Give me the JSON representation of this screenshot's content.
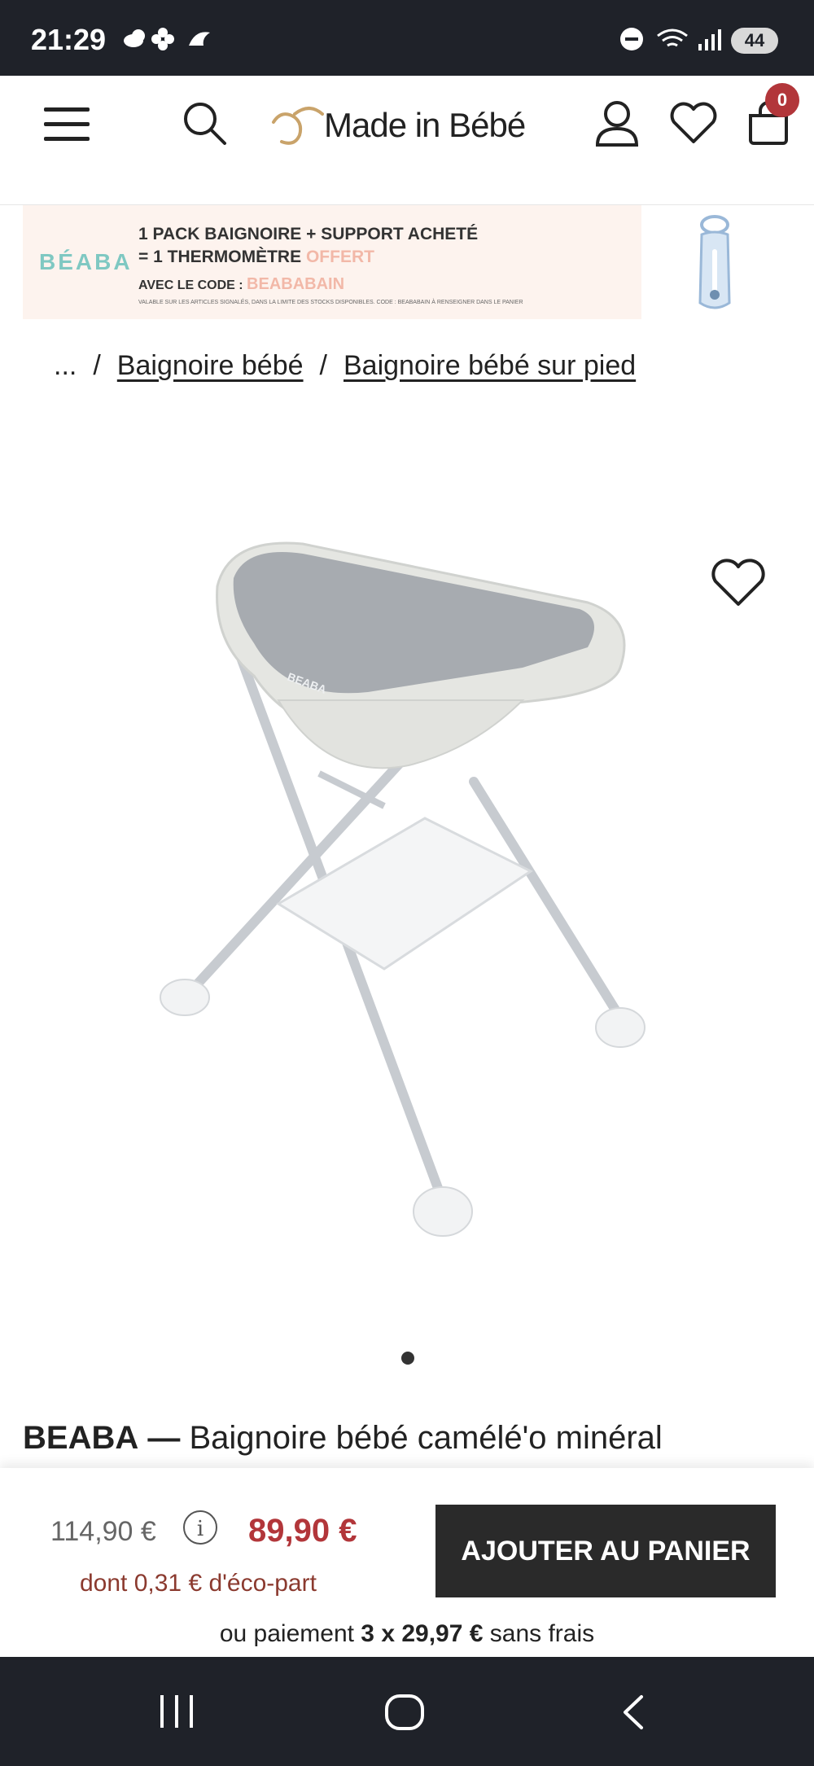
{
  "status_bar": {
    "time": "21:29",
    "battery": "44"
  },
  "header": {
    "logo": "Made in Bébé",
    "cart_count": "0"
  },
  "promo": {
    "brand": "BÉABA",
    "line1": "1 PACK BAIGNOIRE + SUPPORT ACHETÉ",
    "line2_prefix": "= 1 THERMOMÈTRE ",
    "line2_offer": "OFFERT",
    "line3_prefix": "AVEC LE CODE : ",
    "line3_code": "BEABABAIN",
    "fine_print": "VALABLE SUR LES ARTICLES SIGNALÉS, DANS LA LIMITE DES STOCKS DISPONIBLES. CODE : BEABABAIN À RENSEIGNER DANS LE PANIER"
  },
  "breadcrumb": {
    "ellipsis": "...",
    "sep1": "/",
    "item1": "Baignoire bébé",
    "sep2": "/",
    "item2": "Baignoire bébé sur pied"
  },
  "product": {
    "brand": "BEABA",
    "dash": "—",
    "name": "Baignoire bébé camélé'o minéral"
  },
  "purchase": {
    "old_price": "114,90 €",
    "info": "i",
    "new_price": "89,90 €",
    "eco_part": "dont 0,31 € d'éco-part",
    "add_to_cart": "AJOUTER AU PANIER",
    "installment_prefix": "ou paiement ",
    "installment_amount": "3 x 29,97 €",
    "installment_suffix": " sans frais"
  }
}
